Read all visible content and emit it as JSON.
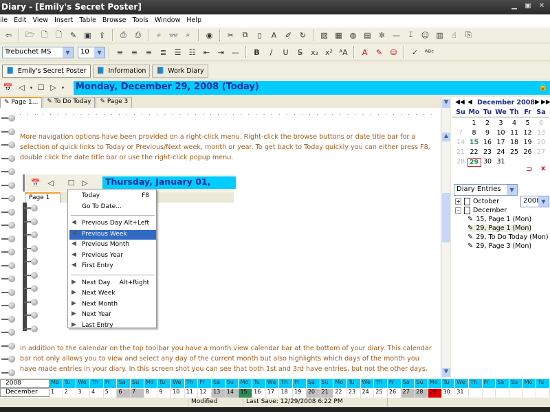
{
  "window": {
    "title": "Diary - [Emily's Secret Poster]"
  },
  "menu": [
    "ile",
    "Edit",
    "View",
    "Insert",
    "Table",
    "Browse",
    "Tools",
    "Window",
    "Help"
  ],
  "format": {
    "font": "Trebuchet MS",
    "size": "10"
  },
  "diaries": [
    {
      "label": "Emily's Secret Poster",
      "active": true
    },
    {
      "label": "Information"
    },
    {
      "label": "Work Diary"
    }
  ],
  "date_title": "Monday, December 29, 2008 (Today)",
  "page_tabs": [
    {
      "label": "Page 1...",
      "active": true
    },
    {
      "label": "To Do Today"
    },
    {
      "label": "Page 3"
    }
  ],
  "content": {
    "para1": "More navigation options have been provided on a right-click menu. Right-click the browse buttons or date title bar for a selection of quick links to Today or Previous/Next week, month or year. To get back to Today quickly you can either press F8, double click the date title bar or use the right-click popup menu.",
    "para2": "In addition to the calendar on the top toolbar you have a month view calendar bar at the bottom of your diary. This calendar bar not only allows you to view and select any day of the current month but also highlights which days of the month you have made entries in your diary. In this screen shot you can see that both 1st and 3rd have entries, but not the other days.",
    "inner_date": "Thursday, January 01, 2009",
    "inner_tab": "Page 1"
  },
  "context_menu": [
    {
      "label": "Today",
      "shortcut": "F8"
    },
    {
      "label": "Go To Date..."
    },
    {
      "sep": true
    },
    {
      "label": "Previous Day",
      "shortcut": "Alt+Left",
      "icon": "prev"
    },
    {
      "label": "Previous Week",
      "icon": "prev",
      "highlighted": true
    },
    {
      "label": "Previous Month",
      "icon": "prev"
    },
    {
      "label": "Previous Year",
      "icon": "prev"
    },
    {
      "label": "First Entry",
      "icon": "prev"
    },
    {
      "sep": true
    },
    {
      "label": "Next Day",
      "shortcut": "Alt+Right",
      "icon": "next"
    },
    {
      "label": "Next Week",
      "icon": "next"
    },
    {
      "label": "Next Month",
      "icon": "next"
    },
    {
      "label": "Next Year",
      "icon": "next"
    },
    {
      "label": "Last Entry",
      "icon": "next"
    }
  ],
  "calendar": {
    "title": "December 2008",
    "weekdays": [
      "Su",
      "Mo",
      "Tu",
      "We",
      "Th",
      "Fr",
      "Sa"
    ],
    "weeks": [
      [
        "",
        "1",
        "2",
        "3",
        "4",
        "5",
        "6"
      ],
      [
        "7",
        "8",
        "9",
        "10",
        "11",
        "12",
        "13"
      ],
      [
        "14",
        "15",
        "16",
        "17",
        "18",
        "19",
        "20"
      ],
      [
        "21",
        "22",
        "23",
        "24",
        "25",
        "26",
        "27"
      ],
      [
        "28",
        "29",
        "30",
        "31",
        "",
        "",
        ""
      ]
    ],
    "entry_days": [
      "15",
      "29"
    ],
    "today": "29"
  },
  "filter": {
    "view": "Diary Entries",
    "year": "2008"
  },
  "tree": [
    {
      "label": "October",
      "level": 0,
      "expander": "+",
      "icon": "doc"
    },
    {
      "label": "December",
      "level": 0,
      "expander": "-",
      "icon": "doc"
    },
    {
      "label": "15, Page 1 (Mon)",
      "level": 1,
      "icon": "page"
    },
    {
      "label": "29, Page 1 (Mon)",
      "level": 1,
      "icon": "page",
      "selected": true
    },
    {
      "label": "29, To Do Today (Mon)",
      "level": 1,
      "icon": "page"
    },
    {
      "label": "29, Page 3 (Mon)",
      "level": 1,
      "icon": "page"
    }
  ],
  "month_bar": {
    "year": "2008",
    "month": "December",
    "weekdays": [
      "Mo",
      "Tu",
      "We",
      "Th",
      "Fr",
      "Sa",
      "Su",
      "Mo",
      "Tu",
      "We",
      "Th",
      "Fr",
      "Sa",
      "Su",
      "Mo",
      "Tu",
      "We",
      "Th",
      "Fr",
      "Sa",
      "Su",
      "Mo",
      "Tu",
      "We",
      "Th",
      "Fr",
      "Sa",
      "Su",
      "Mo",
      "Tu",
      "We",
      "Th",
      "Fr",
      "Sa",
      "Su",
      "Mo",
      "Tu"
    ],
    "days": [
      "1",
      "2",
      "3",
      "4",
      "5",
      "6",
      "7",
      "8",
      "9",
      "10",
      "11",
      "12",
      "13",
      "14",
      "15",
      "16",
      "17",
      "18",
      "19",
      "20",
      "21",
      "22",
      "23",
      "24",
      "25",
      "26",
      "27",
      "28",
      "29",
      "30",
      "31"
    ],
    "weekend_days": [
      "6",
      "7",
      "13",
      "14",
      "20",
      "21",
      "27",
      "28"
    ],
    "entry_day": "15",
    "today": "29"
  },
  "status": {
    "state": "Modified",
    "last_save": "Last Save: 12/29/2008 6:22 PM"
  },
  "colors": {
    "date_bar": "#00ccff",
    "date_text": "#0a2d9c",
    "body_text": "#a55a1a",
    "highlight": "#316ac5",
    "entry": "#2d8b57",
    "today_cell": "#e00000",
    "weekend": "#c0c0c0"
  }
}
